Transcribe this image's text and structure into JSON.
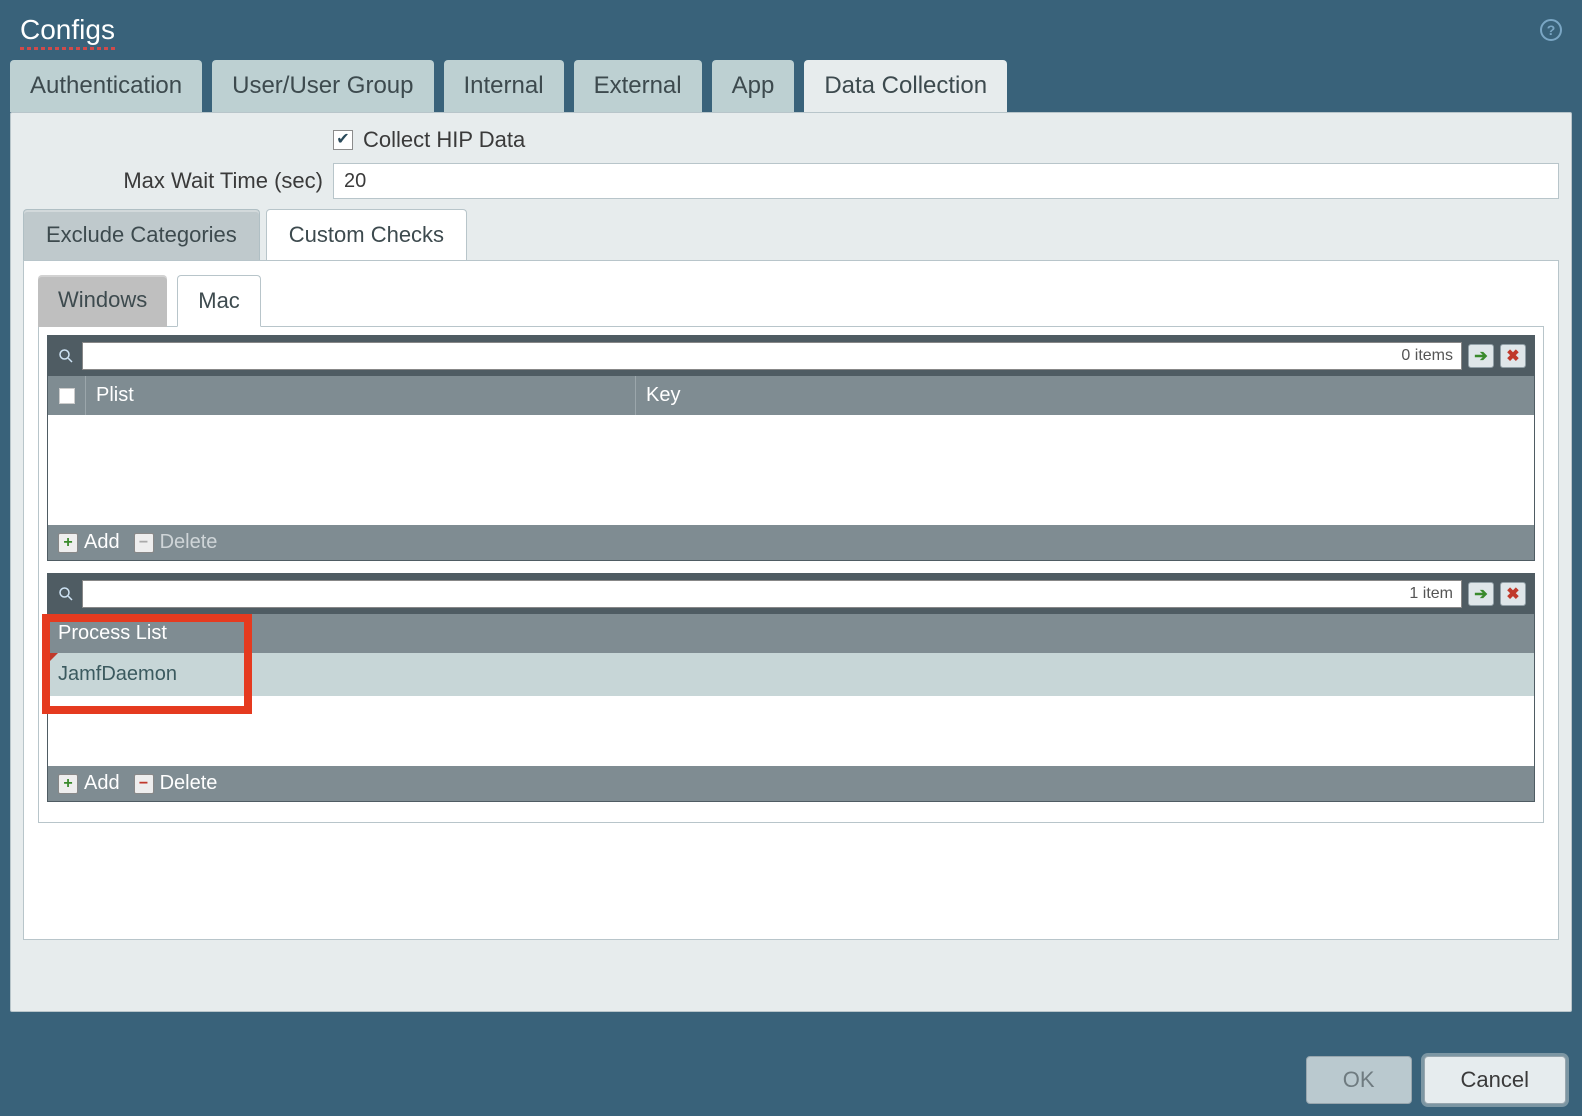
{
  "header": {
    "title": "Configs"
  },
  "tabs": [
    "Authentication",
    "User/User Group",
    "Internal",
    "External",
    "App",
    "Data Collection"
  ],
  "active_tab": 5,
  "form": {
    "collect_label": "Collect HIP Data",
    "collect_checked": true,
    "maxwait_label": "Max Wait Time (sec)",
    "maxwait_value": "20"
  },
  "subtabs": [
    "Exclude Categories",
    "Custom Checks"
  ],
  "active_subtab": 1,
  "ostabs": [
    "Windows",
    "Mac"
  ],
  "active_ostab": 1,
  "grid1": {
    "search_value": "",
    "item_count": "0 items",
    "headers": {
      "plist": "Plist",
      "key": "Key"
    },
    "rows": []
  },
  "grid2": {
    "search_value": "",
    "item_count": "1 item",
    "headers": {
      "proc": "Process List"
    },
    "rows": [
      {
        "proc": "JamfDaemon"
      }
    ]
  },
  "footer_labels": {
    "add": "Add",
    "delete": "Delete"
  },
  "buttons": {
    "ok": "OK",
    "cancel": "Cancel"
  }
}
